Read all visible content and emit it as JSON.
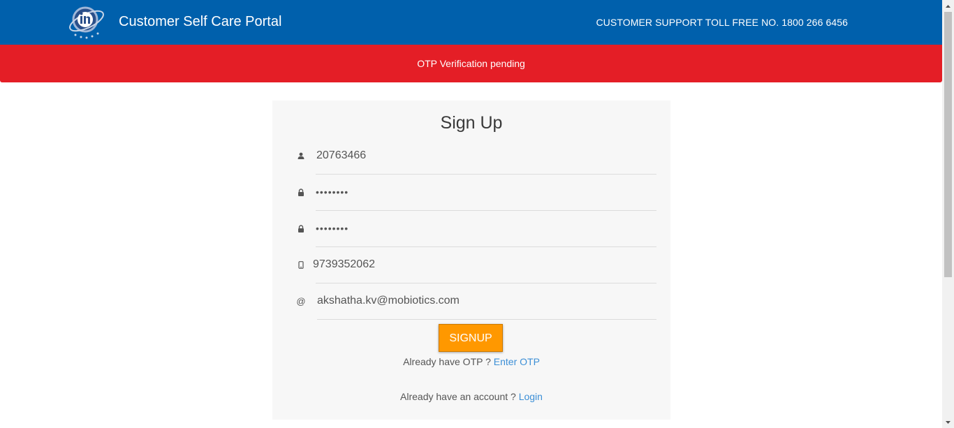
{
  "header": {
    "title": "Customer Self Care Portal",
    "support": "CUSTOMER SUPPORT TOLL FREE NO. 1800 266 6456",
    "brand_color": "#0060ac"
  },
  "alert": {
    "message": "OTP Verification pending",
    "color": "#e41e26"
  },
  "form": {
    "title": "Sign Up",
    "fields": [
      {
        "icon": "user-icon",
        "value": "20763466"
      },
      {
        "icon": "lock-icon",
        "value": "••••••••"
      },
      {
        "icon": "lock-icon",
        "value": "••••••••"
      },
      {
        "icon": "mobile-icon",
        "value": "9739352062"
      },
      {
        "icon": "at-icon",
        "value": "akshatha.kv@mobiotics.com",
        "icon_text": "@"
      }
    ],
    "signup_label": "SIGNUP",
    "signup_color": "#ff9800",
    "otp_prompt": "Already have OTP ?",
    "otp_link": "Enter OTP",
    "login_prompt": "Already have an account ?",
    "login_link": "Login",
    "link_color": "#3c8fd6"
  }
}
